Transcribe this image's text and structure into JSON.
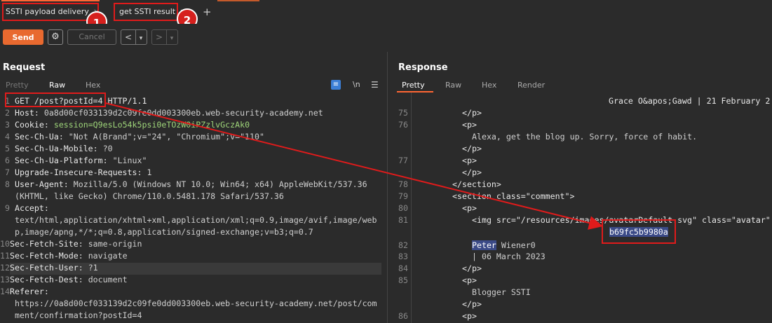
{
  "tabs": [
    {
      "label": "SSTI payload delivery",
      "close": "×"
    },
    {
      "label": "get SSTI result",
      "close": "×"
    }
  ],
  "new_tab": "+",
  "badges": [
    "1",
    "2"
  ],
  "toolbar": {
    "send": "Send",
    "gear": "⚙",
    "cancel": "Cancel",
    "back": "<",
    "back_drop": "▾",
    "fwd": ">",
    "fwd_drop": "▾"
  },
  "request": {
    "title": "Request",
    "subtabs": [
      "Pretty",
      "Raw",
      "Hex"
    ],
    "active_subtab": "Raw",
    "icons": {
      "wrap": "≡",
      "newline": "\\n",
      "menu": "☰"
    },
    "lines": [
      {
        "n": "1",
        "text": "GET /post?postId=4 HTTP/1.1"
      },
      {
        "n": "2",
        "key": "Host",
        "value": "0a8d00cf033139d2c09fe0dd003300eb.web-security-academy.net"
      },
      {
        "n": "3",
        "key": "Cookie",
        "value": "session=Q9esLo54k5psi0eTOzW0iPZzlvGczAk0"
      },
      {
        "n": "4",
        "key": "Sec-Ch-Ua",
        "value": "\"Not A(Brand\";v=\"24\", \"Chromium\";v=\"110\""
      },
      {
        "n": "5",
        "key": "Sec-Ch-Ua-Mobile",
        "value": "?0"
      },
      {
        "n": "6",
        "key": "Sec-Ch-Ua-Platform",
        "value": "\"Linux\""
      },
      {
        "n": "7",
        "key": "Upgrade-Insecure-Requests",
        "value": "1"
      },
      {
        "n": "8",
        "key": "User-Agent",
        "value": "Mozilla/5.0 (Windows NT 10.0; Win64; x64) AppleWebKit/537.36"
      },
      {
        "n": "",
        "text": "(KHTML, like Gecko) Chrome/110.0.5481.178 Safari/537.36"
      },
      {
        "n": "9",
        "key": "Accept",
        "value": ""
      },
      {
        "n": "",
        "text": "text/html,application/xhtml+xml,application/xml;q=0.9,image/avif,image/web"
      },
      {
        "n": "",
        "text": "p,image/apng,*/*;q=0.8,application/signed-exchange;v=b3;q=0.7"
      },
      {
        "n": "10",
        "key": "Sec-Fetch-Site",
        "value": "same-origin"
      },
      {
        "n": "11",
        "key": "Sec-Fetch-Mode",
        "value": "navigate"
      },
      {
        "n": "12",
        "key": "Sec-Fetch-User",
        "value": "?1"
      },
      {
        "n": "13",
        "key": "Sec-Fetch-Dest",
        "value": "document"
      },
      {
        "n": "14",
        "key": "Referer",
        "value": ""
      },
      {
        "n": "",
        "text": "https://0a8d00cf033139d2c09fe0dd003300eb.web-security-academy.net/post/com"
      },
      {
        "n": "",
        "text": "ment/confirmation?postId=4"
      }
    ]
  },
  "response": {
    "title": "Response",
    "subtabs": [
      "Pretty",
      "Raw",
      "Hex",
      "Render"
    ],
    "active_subtab": "Pretty",
    "lines": [
      {
        "n": "",
        "indent": 41,
        "text": "Grace O&apos;Gawd | 21 February 2"
      },
      {
        "n": "75",
        "indent": 10,
        "text": "</p>"
      },
      {
        "n": "76",
        "indent": 10,
        "text": "<p>"
      },
      {
        "n": "",
        "indent": 12,
        "text": "Alexa, get the blog up. Sorry, force of habit."
      },
      {
        "n": "",
        "indent": 10,
        "text": "</p>"
      },
      {
        "n": "77",
        "indent": 10,
        "text": "<p>"
      },
      {
        "n": "",
        "indent": 10,
        "text": "</p>"
      },
      {
        "n": "78",
        "indent": 8,
        "text": "</section>"
      },
      {
        "n": "79",
        "indent": 8,
        "text": "<section class=\"comment\">"
      },
      {
        "n": "80",
        "indent": 10,
        "text": "<p>"
      },
      {
        "n": "81",
        "indent": 12,
        "text": "<img src=\"/resources/images/avatarDefault.svg\" class=\"avatar\""
      },
      {
        "n": "",
        "indent": 0,
        "text": "b69fc5b9980a"
      },
      {
        "n": "82",
        "indent": 12,
        "text": "Peter Wiener0"
      },
      {
        "n": "83",
        "indent": 12,
        "text": "| 06 March 2023"
      },
      {
        "n": "84",
        "indent": 10,
        "text": "</p>"
      },
      {
        "n": "85",
        "indent": 10,
        "text": "<p>"
      },
      {
        "n": "",
        "indent": 12,
        "text": "Blogger SSTI"
      },
      {
        "n": "",
        "indent": 10,
        "text": "</p>"
      },
      {
        "n": "86",
        "indent": 10,
        "text": "<p>"
      }
    ],
    "result_value": "b69fc5b9980a",
    "selected_word": "Peter",
    "after_selected": " Wiener0"
  }
}
